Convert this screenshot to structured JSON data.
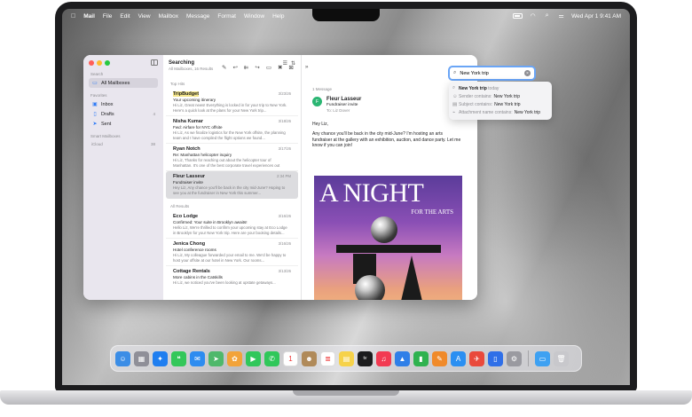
{
  "menubar": {
    "apple_icon": "apple-logo",
    "items": [
      "Mail",
      "File",
      "Edit",
      "View",
      "Mailbox",
      "Message",
      "Format",
      "Window",
      "Help"
    ],
    "datetime": "Wed Apr 1  9:41 AM"
  },
  "sidebar": {
    "search_label": "Search",
    "all_mailboxes": "All Mailboxes",
    "favorites_label": "Favorites",
    "inbox": "Inbox",
    "drafts": "Drafts",
    "drafts_count": "4",
    "sent": "Sent",
    "smart_mailboxes": "Smart Mailboxes",
    "icloud": "iCloud",
    "icloud_count": "38"
  },
  "list": {
    "title": "Searching",
    "subtitle": "All Mailboxes, 16 Results",
    "top_hits_label": "Top Hits",
    "all_results_label": "All Results",
    "top_hits": [
      {
        "sender": "TripBudget",
        "date": "3/23/26",
        "subject": "Your upcoming itinerary",
        "preview": "Hi Liz, Great news! Everything is locked in for your trip to New York. Here's a quick look at the plans for your New York trip..."
      },
      {
        "sender": "Nisha Kumar",
        "date": "3/18/26",
        "subject": "Fwd: Airfare for NYC offsite",
        "preview": "Hi Liz, As we finalize logistics for the New York offsite, the planning team and I have compiled the flight options we found..."
      },
      {
        "sender": "Ryan Notch",
        "date": "3/17/26",
        "subject": "Re: Manhattan helicopter inquiry",
        "preview": "Hi Liz, Thanks for reaching out about the helicopter tour of Manhattan. It's one of the best corporate travel experiences out there..."
      },
      {
        "sender": "Fleur Lasseur",
        "date": "2:34 PM",
        "subject": "Fundraiser invite",
        "preview": "Hey Liz, Any chance you'll be back in the city mid-June? Hoping to see you at the fundraiser in New York this summer..."
      }
    ],
    "all_results": [
      {
        "sender": "Eco Lodge",
        "date": "3/16/26",
        "subject": "Confirmed: Your suite in Brooklyn awaits!",
        "preview": "Hello Liz, We're thrilled to confirm your upcoming stay at Eco Lodge in Brooklyn for your New York trip. Here are your booking details..."
      },
      {
        "sender": "Jenica Chong",
        "date": "3/16/26",
        "subject": "Hotel conference rooms",
        "preview": "Hi Liz, My colleague forwarded your email to me. We'd be happy to host your offsite at our hotel in New York. Our rooms..."
      },
      {
        "sender": "Cottage Rentals",
        "date": "3/13/26",
        "subject": "More cabins in the Catskills",
        "preview": "Hi Liz, we noticed you've been looking at upstate getaways..."
      }
    ]
  },
  "reader": {
    "message_count": "1 Message",
    "from_name": "Fleur Lasseur",
    "from_subject": "Fundraiser invite",
    "to_label": "To:",
    "to_name": "Liz Dover",
    "date": "2:34 PM",
    "greeting": "Hey Liz,",
    "body": "Any chance you'll be back in the city mid-June? I'm hosting an arts fundraiser at the gallery with an exhibition, auction, and dance party. Let me know if you can join!",
    "poster_title": "A NIGHT",
    "poster_subtitle": "FOR THE ARTS"
  },
  "search": {
    "query": "New York trip",
    "suggestions": [
      {
        "label": "",
        "query": "New York trip",
        "suffix": "today"
      },
      {
        "label": "Sender contains:",
        "query": "New York trip",
        "suffix": ""
      },
      {
        "label": "Subject contains:",
        "query": "New York trip",
        "suffix": ""
      },
      {
        "label": "Attachment name contains:",
        "query": "New York trip",
        "suffix": ""
      }
    ]
  },
  "dock": {
    "apps": [
      {
        "name": "finder",
        "color": "#3b8de6",
        "glyph": "☺"
      },
      {
        "name": "launchpad",
        "color": "#8f8f98",
        "glyph": "▦"
      },
      {
        "name": "safari",
        "color": "#1f7ef0",
        "glyph": "✦"
      },
      {
        "name": "messages",
        "color": "#33c75a",
        "glyph": "❝"
      },
      {
        "name": "mail",
        "color": "#2d8cf0",
        "glyph": "✉"
      },
      {
        "name": "maps",
        "color": "#4fb86b",
        "glyph": "➤"
      },
      {
        "name": "photos",
        "color": "#f2a33a",
        "glyph": "✿"
      },
      {
        "name": "facetime",
        "color": "#30c75a",
        "glyph": "▶"
      },
      {
        "name": "phone",
        "color": "#30c75a",
        "glyph": "✆"
      },
      {
        "name": "calendar",
        "color": "#ffffff",
        "glyph": "1"
      },
      {
        "name": "contacts",
        "color": "#b08a5a",
        "glyph": "☻"
      },
      {
        "name": "reminders",
        "color": "#ffffff",
        "glyph": "≣"
      },
      {
        "name": "notes",
        "color": "#f6d24a",
        "glyph": "▤"
      },
      {
        "name": "tv",
        "color": "#1c1c1e",
        "glyph": "tv"
      },
      {
        "name": "music",
        "color": "#f23a52",
        "glyph": "♫"
      },
      {
        "name": "keynote",
        "color": "#2f7fe8",
        "glyph": "▲"
      },
      {
        "name": "numbers",
        "color": "#2fb24f",
        "glyph": "▮"
      },
      {
        "name": "pages",
        "color": "#f08a2a",
        "glyph": "✎"
      },
      {
        "name": "app-store",
        "color": "#2a8ff2",
        "glyph": "A"
      },
      {
        "name": "iphone-mirroring",
        "color": "#e9493b",
        "glyph": "✈"
      },
      {
        "name": "system-settings",
        "color": "#2f6fe8",
        "glyph": "▯"
      },
      {
        "name": "settings",
        "color": "#9a9aa0",
        "glyph": "⚙"
      },
      {
        "name": "downloads-folder",
        "color": "#3ea1f2",
        "glyph": "▭"
      },
      {
        "name": "trash",
        "color": "#c8c8cc",
        "glyph": "🗑"
      }
    ],
    "calendar_day": "1",
    "tv_label": "tv"
  }
}
